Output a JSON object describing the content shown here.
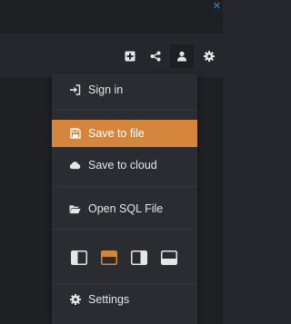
{
  "colors": {
    "accent": "#d6853d",
    "menu_bg": "#2a2c31",
    "text": "#e6e6e6"
  },
  "toolbar": {
    "buttons": [
      {
        "icon": "plus-square-icon"
      },
      {
        "icon": "share-icon"
      },
      {
        "icon": "user-icon",
        "active": true
      },
      {
        "icon": "gear-icon"
      }
    ]
  },
  "menu": {
    "sign_in": "Sign in",
    "save_to_file": "Save to file",
    "save_to_cloud": "Save to cloud",
    "open_sql_file": "Open SQL File",
    "layouts": [
      {
        "icon": "layout-left-panel-icon"
      },
      {
        "icon": "layout-top-panel-icon",
        "selected": true
      },
      {
        "icon": "layout-right-panel-icon"
      },
      {
        "icon": "layout-bottom-panel-icon"
      }
    ],
    "settings": "Settings"
  }
}
